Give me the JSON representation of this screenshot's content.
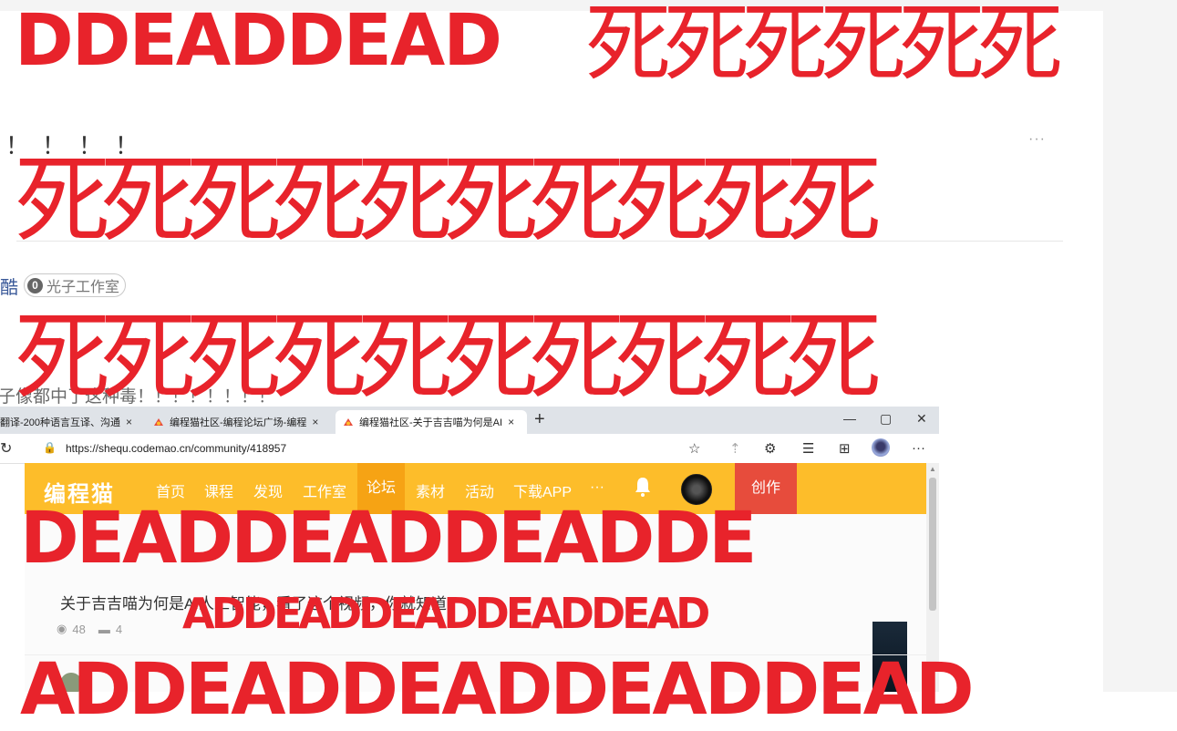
{
  "overlay": {
    "top_banner_latin": "DDEADDEAD",
    "top_banner_cjk": "死死死死死死",
    "row2": "死死死死死死死死死死",
    "row3": "死死死死死死死死死死",
    "big_dead_1": "DEADDEADDEADDE",
    "big_dead_2": "ADDEADDEADDEADDEAD",
    "big_dead_3": "ADDEADDEADDEADDEAD"
  },
  "post": {
    "title_tail": "！！！！",
    "more_label": "···",
    "author_name": "酷",
    "studio_level": "0",
    "studio_name": "光子工作室",
    "body_text": "子像都中了这种毒！！！！！！！！"
  },
  "screenshot": {
    "tabs": [
      {
        "label": "翻译-200种语言互译、沟通",
        "close": "×"
      },
      {
        "label": "编程猫社区-编程论坛广场-编程",
        "close": "×"
      },
      {
        "label": "编程猫社区-关于吉吉喵为何是AI",
        "close": "×"
      }
    ],
    "new_tab": "+",
    "window_controls": [
      "—",
      "▢",
      "✕"
    ],
    "url": "https://shequ.codemao.cn/community/418957",
    "nav": {
      "logo": "编程猫",
      "items": [
        "首页",
        "课程",
        "发现",
        "工作室",
        "论坛",
        "素材",
        "活动",
        "下载APP",
        "···"
      ],
      "active_item": "论坛",
      "create_label": "创作"
    },
    "post_title": "关于吉吉喵为何是AI人工智能，看了这个视频，你就知道",
    "views": "48",
    "comments": "4"
  },
  "colors": {
    "overlay_red": "#e8232b",
    "nav_yellow": "#fdbd2a",
    "create_red": "#e74c3c",
    "author_blue": "#3b5a9a"
  }
}
